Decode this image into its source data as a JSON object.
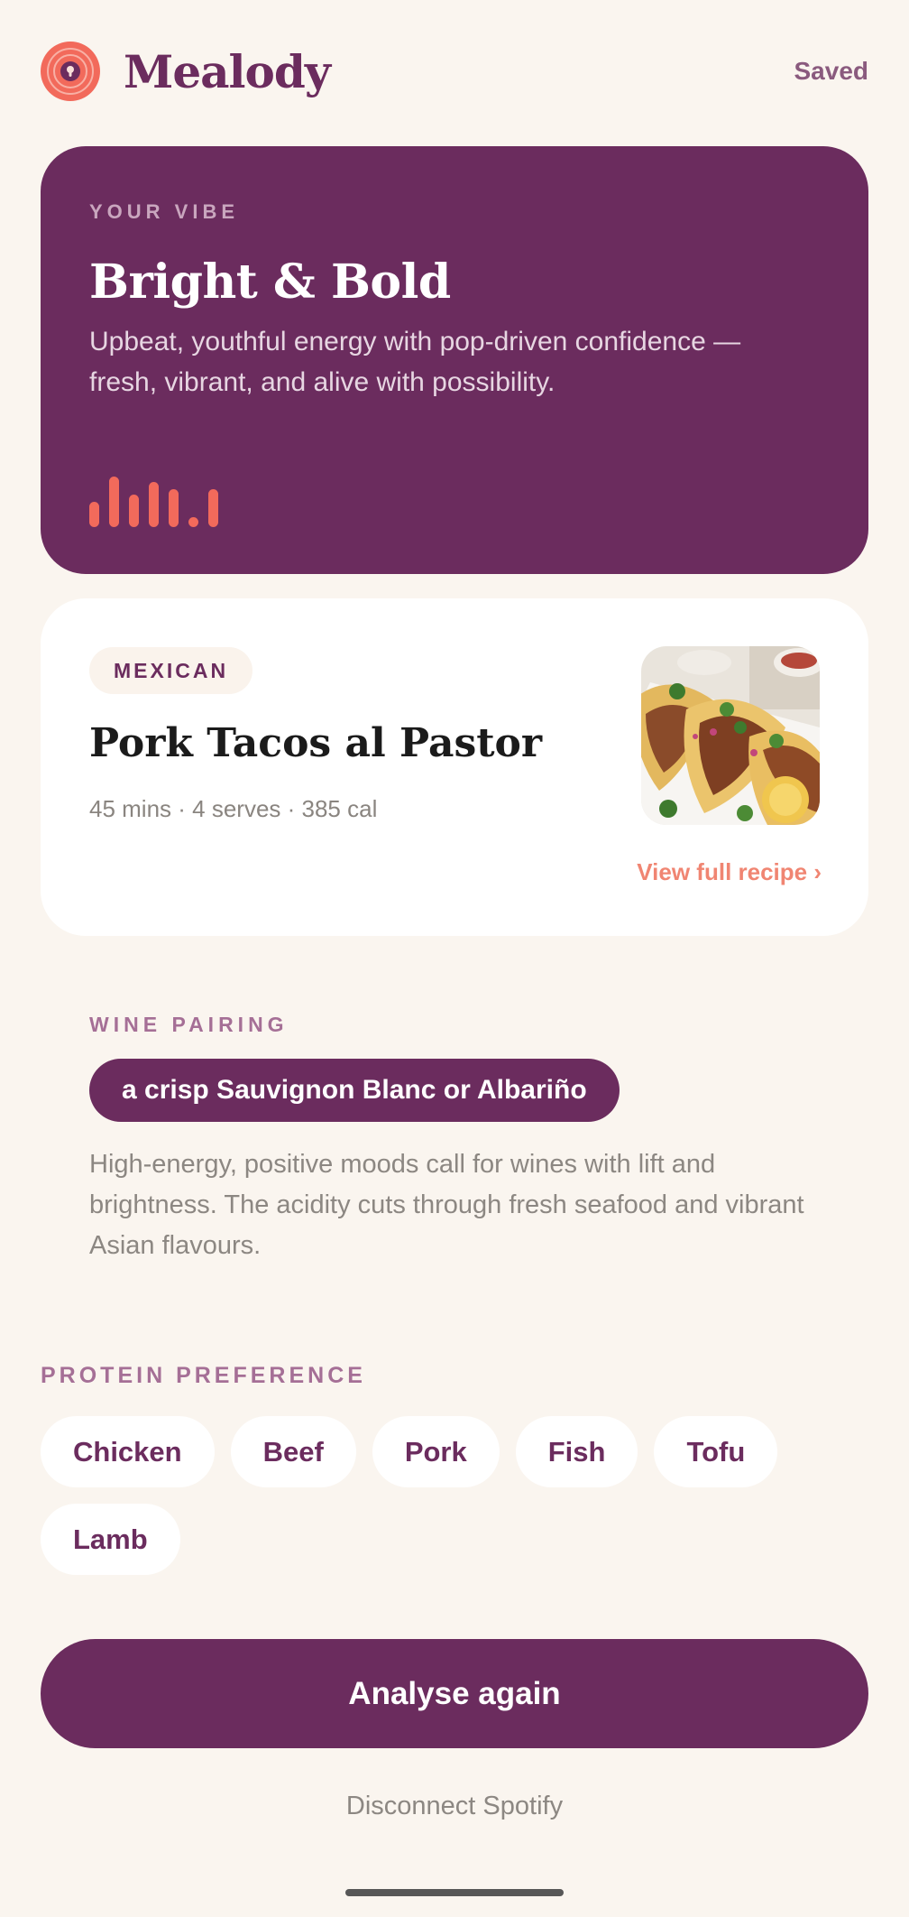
{
  "header": {
    "app_name": "Mealody",
    "saved_label": "Saved",
    "logo_icon": "record-logo-icon"
  },
  "vibe": {
    "eyebrow": "YOUR VIBE",
    "title": "Bright & Bold",
    "description": "Upbeat, youthful energy with pop-driven confidence — fresh, vibrant, and alive with possibility.",
    "bars_icon": "audio-bars-icon",
    "bar_levels": [
      0.5,
      1.0,
      0.65,
      0.9,
      0.75,
      0.2,
      0.75
    ],
    "accent_color": "#F26A5B"
  },
  "recipe": {
    "cuisine": "MEXICAN",
    "title": "Pork Tacos al Pastor",
    "meta": "45 mins · 4 serves · 385 cal",
    "photo": "tacos-photo",
    "view_link": "View full recipe ›"
  },
  "wine": {
    "eyebrow": "WINE PAIRING",
    "pairing": "a crisp Sauvignon Blanc or Albariño",
    "description": "High-energy, positive moods call for wines with lift and brightness. The acidity cuts through fresh seafood and vibrant Asian flavours."
  },
  "protein": {
    "eyebrow": "PROTEIN PREFERENCE",
    "options": [
      "Chicken",
      "Beef",
      "Pork",
      "Fish",
      "Tofu",
      "Lamb"
    ]
  },
  "actions": {
    "analyse_label": "Analyse again",
    "disconnect_label": "Disconnect Spotify"
  },
  "colors": {
    "brand": "#6B2C5E",
    "background": "#FAF5EF",
    "accent": "#F08572"
  }
}
